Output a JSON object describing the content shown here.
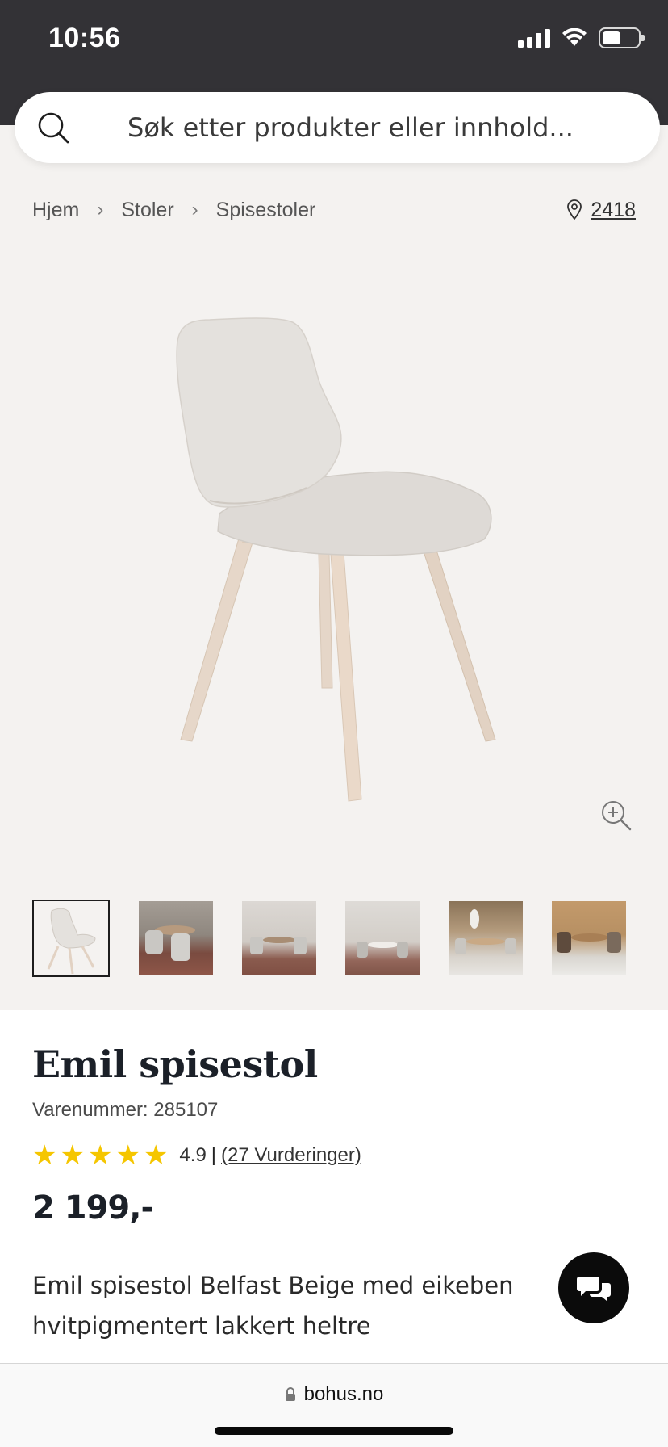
{
  "status_bar": {
    "time": "10:56"
  },
  "search": {
    "placeholder": "Søk etter produkter eller innhold..."
  },
  "breadcrumb": {
    "items": [
      "Hjem",
      "Stoler",
      "Spisestoler"
    ],
    "store_number": "2418"
  },
  "gallery": {
    "thumbnail_count": 6
  },
  "product": {
    "title": "Emil spisestol",
    "sku_label": "Varenummer:",
    "sku_value": "285107",
    "rating": "4.9",
    "rating_stars": 5,
    "reviews_link": "(27 Vurderinger)",
    "price": "2 199,-",
    "description": "Emil spisestol Belfast Beige med eikeben hvitpigmentert lakkert heltre"
  },
  "browser": {
    "url": "bohus.no"
  },
  "colors": {
    "page_background": "#f4f2f0",
    "status_bar": "#333236",
    "star": "#f5c600",
    "title": "#1b2028"
  },
  "icons": {
    "search": "search-icon",
    "location": "location-pin-icon",
    "zoom": "zoom-in-icon",
    "chat": "chat-bubbles-icon",
    "lock": "lock-icon",
    "signal": "cellular-signal-icon",
    "wifi": "wifi-icon",
    "battery": "battery-icon"
  }
}
